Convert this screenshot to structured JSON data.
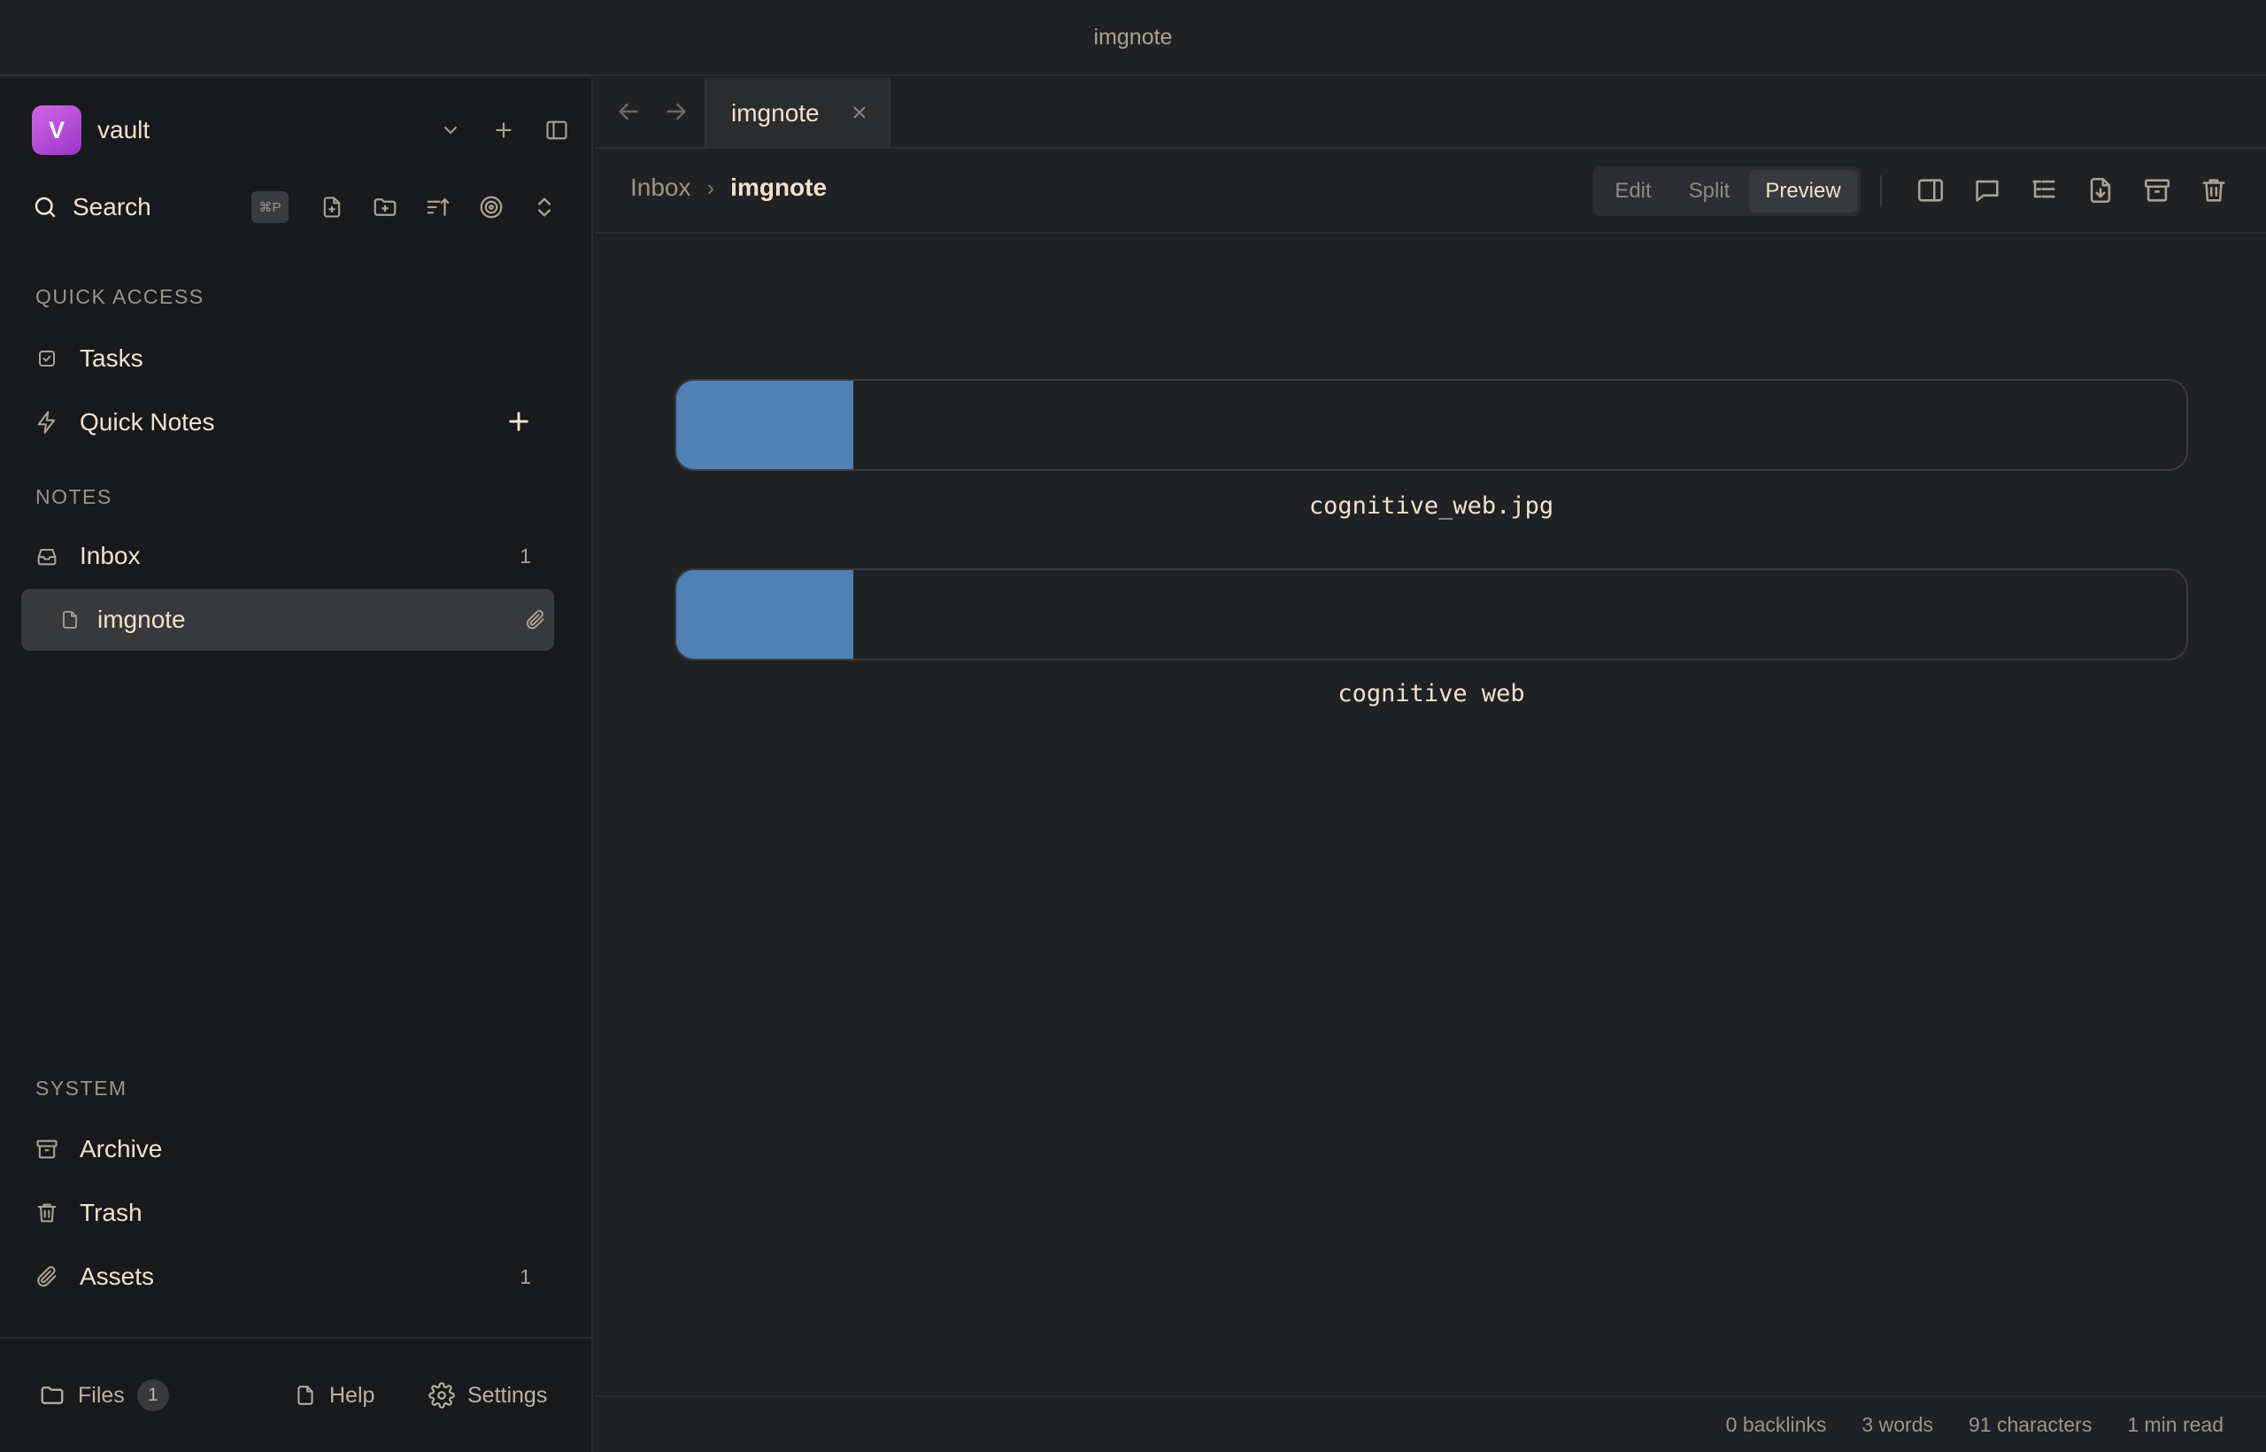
{
  "window": {
    "title": "imgnote"
  },
  "sidebar": {
    "vault": {
      "initial": "V",
      "name": "vault"
    },
    "search": {
      "label": "Search",
      "shortcut": "⌘P"
    },
    "quick_access": {
      "title": "QUICK ACCESS",
      "items": [
        {
          "label": "Tasks"
        },
        {
          "label": "Quick Notes"
        }
      ]
    },
    "notes": {
      "title": "NOTES",
      "folder": {
        "label": "Inbox",
        "count": "1"
      },
      "note": {
        "label": "imgnote"
      }
    },
    "system": {
      "title": "SYSTEM",
      "items": [
        {
          "label": "Archive",
          "count": ""
        },
        {
          "label": "Trash",
          "count": ""
        },
        {
          "label": "Assets",
          "count": "1"
        }
      ]
    },
    "footer": {
      "files_label": "Files",
      "files_count": "1",
      "help_label": "Help",
      "settings_label": "Settings"
    }
  },
  "editor": {
    "tab": {
      "label": "imgnote"
    },
    "breadcrumb": {
      "root": "Inbox",
      "separator": "›",
      "current": "imgnote"
    },
    "modes": [
      {
        "label": "Edit",
        "active": false
      },
      {
        "label": "Split",
        "active": false
      },
      {
        "label": "Preview",
        "active": true
      }
    ],
    "images": [
      {
        "caption": "cognitive_web.jpg",
        "loaded_fraction": 0.117
      },
      {
        "caption": "cognitive web",
        "loaded_fraction": 0.117
      }
    ]
  },
  "status": {
    "backlinks": "0 backlinks",
    "words": "3 words",
    "characters": "91 characters",
    "read_time": "1 min read"
  },
  "colors": {
    "accent_gradient_start": "#d067e6",
    "accent_gradient_end": "#9b34c8",
    "image_placeholder": "#5081b4",
    "background": "#202123",
    "sidebar_background": "#18191b"
  }
}
